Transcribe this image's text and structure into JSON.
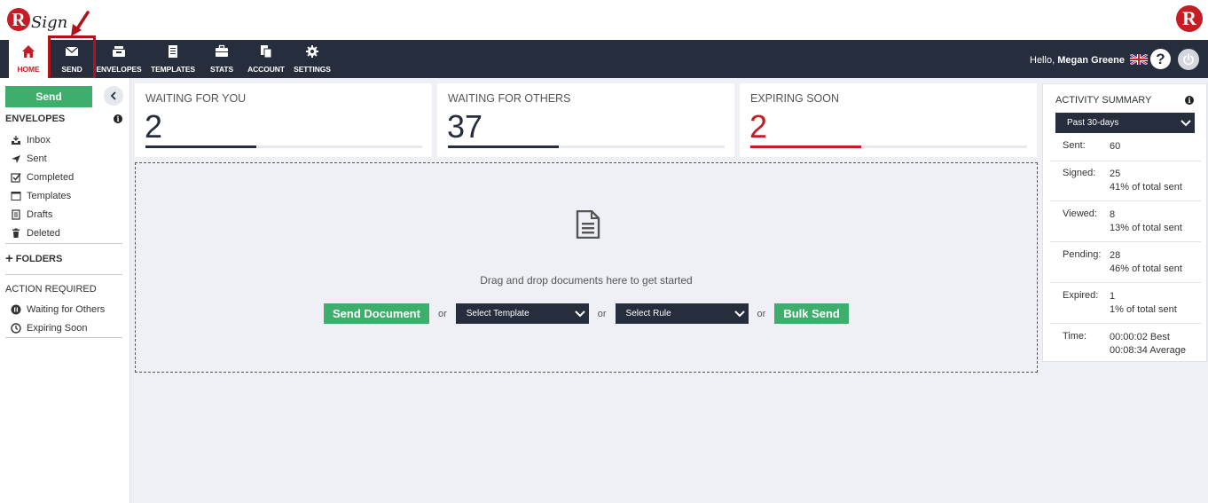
{
  "brand": {
    "logo_letter": "R",
    "logo_word": "Sign",
    "right_logo_letter": "R"
  },
  "nav": {
    "items": [
      {
        "key": "home",
        "label": "HOME",
        "icon": "home-icon"
      },
      {
        "key": "send",
        "label": "SEND",
        "icon": "envelope-icon"
      },
      {
        "key": "envelopes",
        "label": "ENVELOPES",
        "icon": "inbox-tray-icon"
      },
      {
        "key": "templates",
        "label": "TEMPLATES",
        "icon": "book-icon"
      },
      {
        "key": "stats",
        "label": "STATS",
        "icon": "briefcase-icon"
      },
      {
        "key": "account",
        "label": "ACCOUNT",
        "icon": "document-copy-icon"
      },
      {
        "key": "settings",
        "label": "SETTINGS",
        "icon": "gear-icon"
      }
    ],
    "active": "home",
    "highlighted": "send",
    "greeting": "Hello,",
    "user_name": "Megan Greene",
    "help_glyph": "?"
  },
  "sidebar": {
    "send_label": "Send",
    "envelopes_heading": "ENVELOPES",
    "info_glyph": "i",
    "envelope_items": [
      {
        "label": "Inbox",
        "icon": "inbox-icon"
      },
      {
        "label": "Sent",
        "icon": "paper-plane-icon"
      },
      {
        "label": "Completed",
        "icon": "checkbox-icon"
      },
      {
        "label": "Templates",
        "icon": "template-icon"
      },
      {
        "label": "Drafts",
        "icon": "drafts-icon"
      },
      {
        "label": "Deleted",
        "icon": "trash-icon"
      }
    ],
    "folders_label": "FOLDERS",
    "folders_plus": "+",
    "action_heading": "ACTION REQUIRED",
    "action_items": [
      {
        "label": "Waiting for Others",
        "icon": "pause-circle-icon"
      },
      {
        "label": "Expiring Soon",
        "icon": "clock-icon"
      }
    ]
  },
  "cards": [
    {
      "title": "WAITING FOR YOU",
      "value": "2",
      "progress": 0.4
    },
    {
      "title": "WAITING FOR OTHERS",
      "value": "37",
      "progress": 0.4
    },
    {
      "title": "EXPIRING SOON",
      "value": "2",
      "progress": 0.4
    }
  ],
  "dropzone": {
    "text": "Drag and drop documents here to get started",
    "send_document": "Send Document",
    "or": "or",
    "select_template": "Select Template",
    "select_rule": "Select Rule",
    "bulk_send": "Bulk Send"
  },
  "activity": {
    "title": "ACTIVITY SUMMARY",
    "info_glyph": "i",
    "period": "Past 30-days",
    "stats": [
      {
        "label": "Sent:",
        "line1": "60",
        "line2": ""
      },
      {
        "label": "Signed:",
        "line1": "25",
        "line2": "41% of total sent"
      },
      {
        "label": "Viewed:",
        "line1": "8",
        "line2": "13% of total sent"
      },
      {
        "label": "Pending:",
        "line1": "28",
        "line2": "46% of total sent"
      },
      {
        "label": "Expired:",
        "line1": "1",
        "line2": "1% of total sent"
      },
      {
        "label": "Time:",
        "line1": "00:00:02 Best",
        "line2": "00:08:34 Average"
      }
    ]
  },
  "colors": {
    "nav_bg": "#262d3d",
    "accent_red": "#c41e24",
    "green": "#3dae6b",
    "page_bg": "#eef0f6"
  }
}
